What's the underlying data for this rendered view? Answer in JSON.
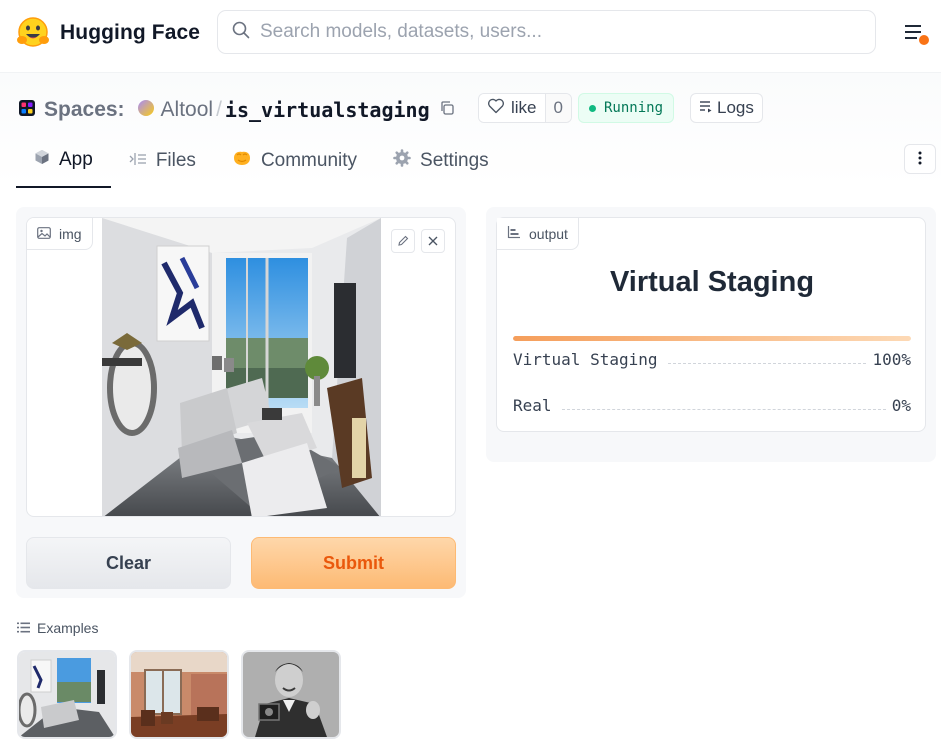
{
  "navbar": {
    "brand": "Hugging Face",
    "search_placeholder": "Search models, datasets, users..."
  },
  "space": {
    "section_label": "Spaces:",
    "owner": "Altool",
    "separator": "/",
    "repo_name": "is_virtualstaging",
    "like_label": "like",
    "like_count": "0",
    "status": "Running",
    "logs_label": "Logs"
  },
  "tabs": [
    {
      "label": "App",
      "icon": "cube-icon",
      "active": true
    },
    {
      "label": "Files",
      "icon": "files-icon",
      "active": false
    },
    {
      "label": "Community",
      "icon": "community-icon",
      "active": false
    },
    {
      "label": "Settings",
      "icon": "gear-icon",
      "active": false
    }
  ],
  "input": {
    "field_label": "img",
    "clear_label": "Clear",
    "submit_label": "Submit"
  },
  "output": {
    "field_label": "output",
    "title": "Virtual Staging",
    "confidences": [
      {
        "label": "Virtual Staging",
        "value": "100%",
        "fraction": 1.0
      },
      {
        "label": "Real",
        "value": "0%",
        "fraction": 0.0
      }
    ]
  },
  "examples": {
    "label": "Examples",
    "items": [
      "staged-living-room",
      "empty-apartment-room",
      "man-holding-camera"
    ]
  },
  "colors": {
    "accent_orange": "#ea580c",
    "status_green": "#047857",
    "progress_orange": "#f59e5b"
  }
}
